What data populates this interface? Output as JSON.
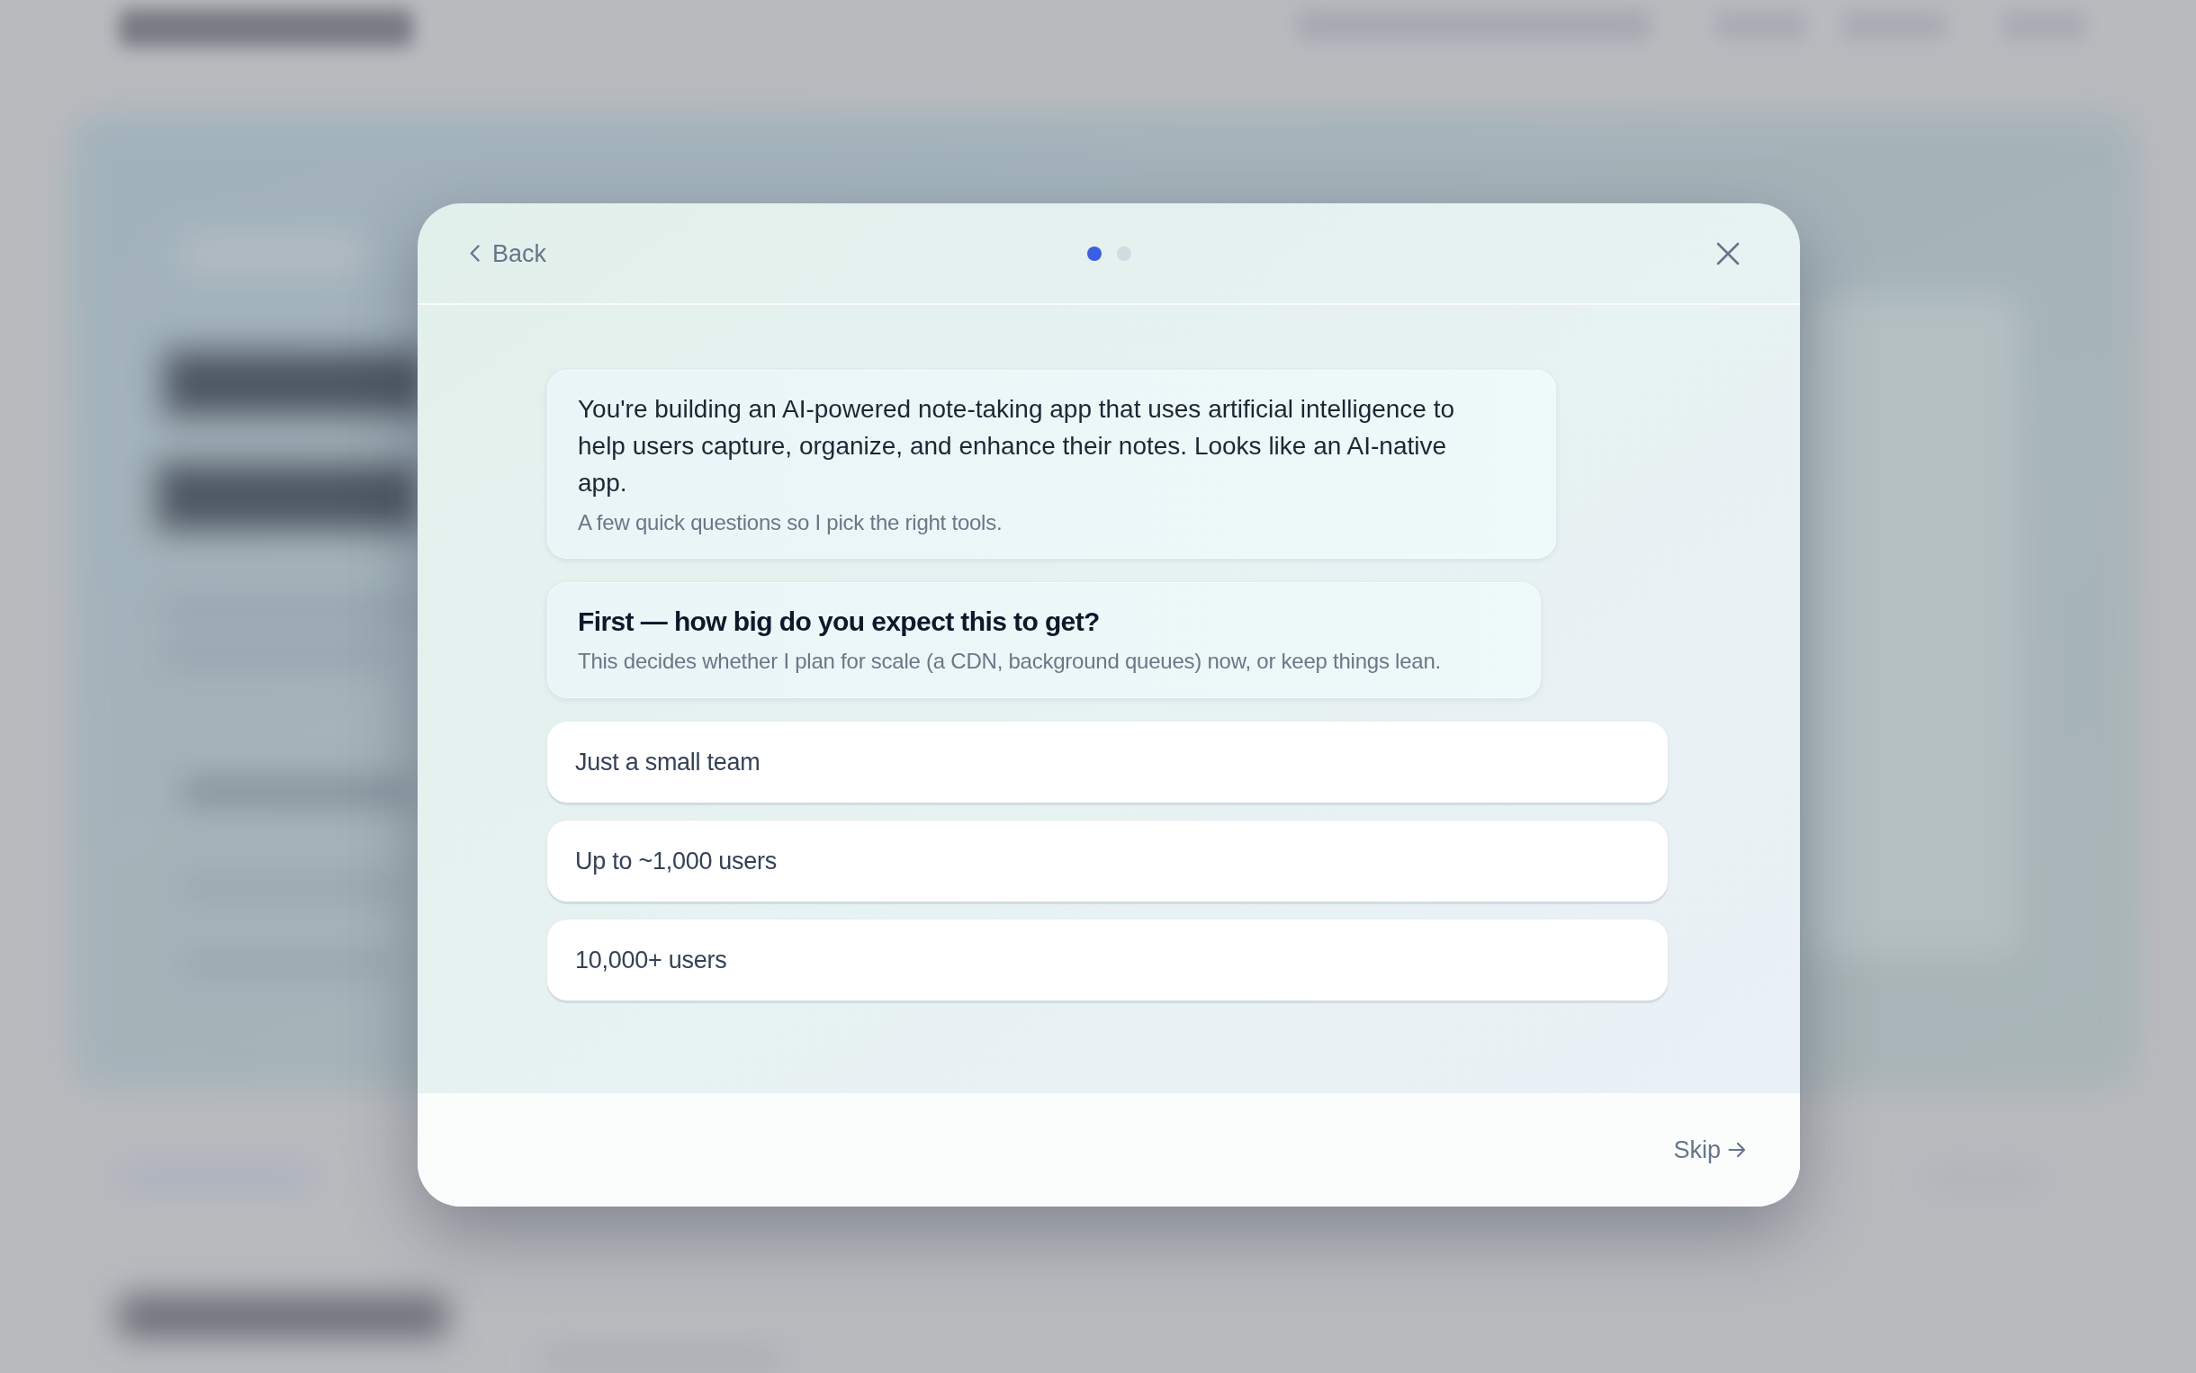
{
  "header": {
    "back_label": "Back",
    "steps": [
      {
        "selected": true
      },
      {
        "selected": false
      }
    ]
  },
  "messages": [
    {
      "kind": "intro",
      "text": "You're building an AI-powered note-taking app that uses artificial intelligence to help users capture, organize, and enhance their notes. Looks like an AI-native app.",
      "note": "A few quick questions so I pick the right tools."
    },
    {
      "kind": "question",
      "title": "First — how big do you expect this to get?",
      "note": "This decides whether I plan for scale (a CDN, background queues) now, or keep things lean."
    }
  ],
  "options": [
    {
      "label": "Just a small team",
      "selected": false
    },
    {
      "label": "Up to ~1,000 users",
      "selected": false
    },
    {
      "label": "10,000+ users",
      "selected": false
    }
  ],
  "footer": {
    "skip_label": "Skip"
  }
}
